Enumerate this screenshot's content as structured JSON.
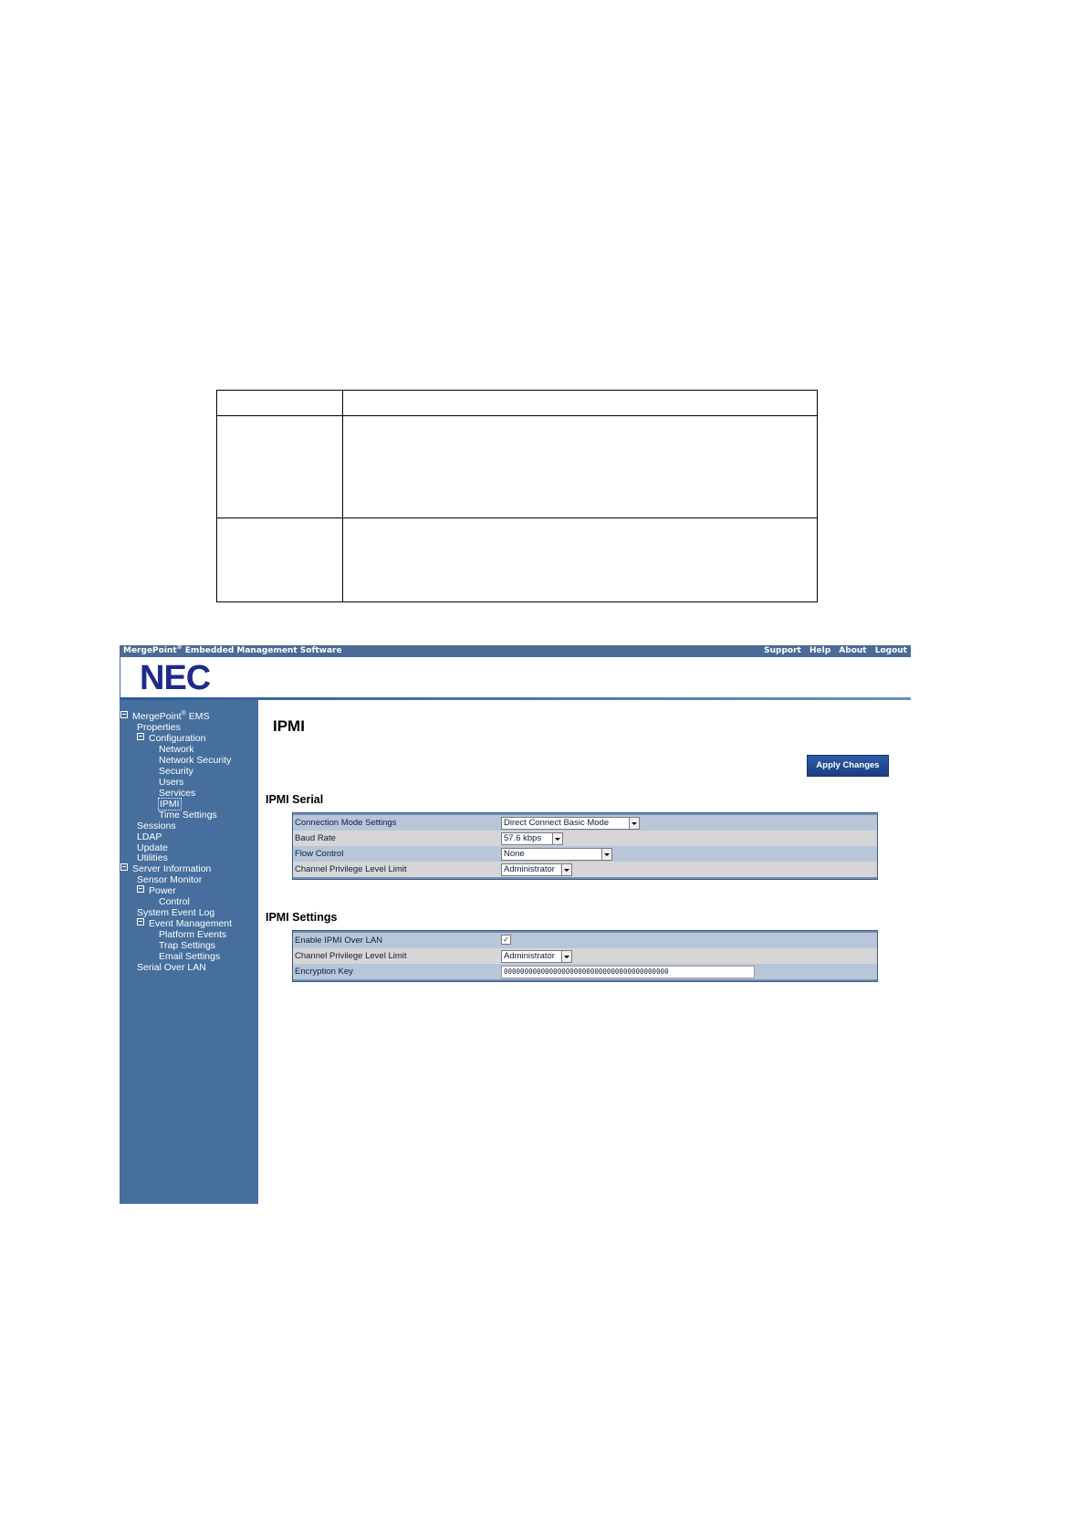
{
  "header": {
    "brand": "MergePoint",
    "brand_reg": "®",
    "brand_rest": " Embedded Management Software",
    "links": [
      "Support",
      "Help",
      "About",
      "Logout"
    ]
  },
  "logo_text": "NEC",
  "sidebar": {
    "root": "MergePoint",
    "root_reg": "®",
    "root_rest": " EMS",
    "items": [
      "Properties",
      "Configuration",
      "Network",
      "Network Security",
      "Security",
      "Users",
      "Services",
      "IPMI",
      "Time Settings",
      "Sessions",
      "LDAP",
      "Update",
      "Utilities",
      "Server Information",
      "Sensor Monitor",
      "Power",
      "Control",
      "System Event Log",
      "Event Management",
      "Platform Events",
      "Trap Settings",
      "Email Settings",
      "Serial Over LAN"
    ]
  },
  "main": {
    "title": "IPMI",
    "apply_label": "Apply Changes",
    "serial": {
      "title": "IPMI Serial",
      "rows": [
        {
          "label": "Connection Mode Settings",
          "value": "Direct Connect Basic Mode"
        },
        {
          "label": "Baud Rate",
          "value": "57.6 kbps"
        },
        {
          "label": "Flow Control",
          "value": "None"
        },
        {
          "label": "Channel Privilege Level Limit",
          "value": "Administrator"
        }
      ]
    },
    "settings": {
      "title": "IPMI Settings",
      "rows": [
        {
          "label": "Enable IPMI Over LAN",
          "value": "✓"
        },
        {
          "label": "Channel Privilege Level Limit",
          "value": "Administrator"
        },
        {
          "label": "Encryption Key",
          "value": "0000000000000000000000000000000000000000"
        }
      ]
    }
  },
  "colors": {
    "sidebar_bg": "#466f9d",
    "topbar_bg": "#4b6b96",
    "logo": "#1f2a8c",
    "button_bg": "#1c3f80"
  }
}
